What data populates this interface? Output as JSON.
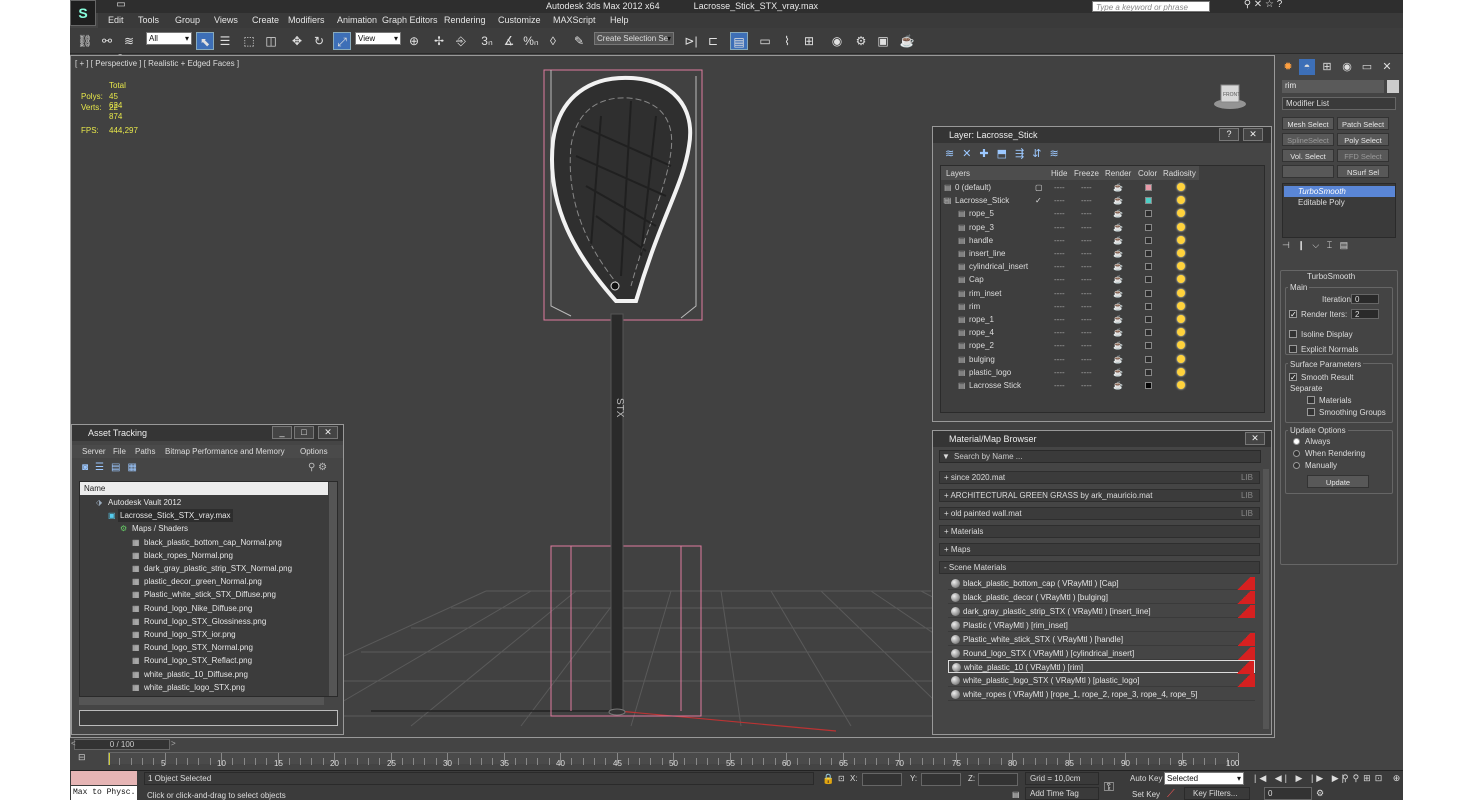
{
  "titlebar": {
    "app": "Autodesk 3ds Max  2012 x64",
    "file": "Lacrosse_Stick_STX_vray.max",
    "search_placeholder": "Type a keyword or phrase"
  },
  "menu": [
    "Edit",
    "Tools",
    "Group",
    "Views",
    "Create",
    "Modifiers",
    "Animation",
    "Graph Editors",
    "Rendering",
    "Customize",
    "MAXScript",
    "Help"
  ],
  "toolbar": {
    "filter": "All",
    "refcoord": "View",
    "selection_set": "Create Selection Se"
  },
  "viewport": {
    "label": "[ + ] [ Perspective ] [ Realistic + Edged Faces ]",
    "stats_header": "Total",
    "polys_label": "Polys:",
    "polys": "45 624",
    "verts_label": "Verts:",
    "verts": "22 874",
    "fps_label": "FPS:",
    "fps": "444,297",
    "viewcube": "FRONT"
  },
  "command_panel": {
    "object_name": "rim",
    "modifier_list": "Modifier List",
    "buttons": [
      [
        "Mesh Select",
        "Patch Select"
      ],
      [
        "SplineSelect",
        "Poly Select"
      ],
      [
        "Vol. Select",
        "FFD Select"
      ],
      [
        "",
        "NSurf Sel"
      ]
    ],
    "stack": [
      "TurboSmooth",
      "Editable Poly"
    ],
    "rollout_title": "TurboSmooth",
    "main_label": "Main",
    "iterations_label": "Iterations:",
    "iterations": "0",
    "render_iters_label": "Render Iters:",
    "render_iters": "2",
    "isoline": "Isoline Display",
    "explicit": "Explicit Normals",
    "surface_label": "Surface Parameters",
    "smooth_result": "Smooth Result",
    "separate": "Separate",
    "materials": "Materials",
    "smoothing_groups": "Smoothing Groups",
    "update_label": "Update Options",
    "always": "Always",
    "when_rendering": "When Rendering",
    "manually": "Manually",
    "update_btn": "Update"
  },
  "layer_window": {
    "title": "Layer: Lacrosse_Stick",
    "columns": [
      "Layers",
      "Hide",
      "Freeze",
      "Render",
      "Color",
      "Radiosity"
    ],
    "rows": [
      {
        "name": "0 (default)",
        "indent": 0,
        "color": "#e89aa8"
      },
      {
        "name": "Lacrosse_Stick",
        "indent": 0,
        "color": "#4ecfc6"
      },
      {
        "name": "rope_5",
        "indent": 1,
        "color": "#2c2c2c"
      },
      {
        "name": "rope_3",
        "indent": 1,
        "color": "#2c2c2c"
      },
      {
        "name": "handle",
        "indent": 1,
        "color": "#2c2c2c"
      },
      {
        "name": "insert_line",
        "indent": 1,
        "color": "#2c2c2c"
      },
      {
        "name": "cylindrical_insert",
        "indent": 1,
        "color": "#2c2c2c"
      },
      {
        "name": "Cap",
        "indent": 1,
        "color": "#2c2c2c"
      },
      {
        "name": "rim_inset",
        "indent": 1,
        "color": "#2c2c2c"
      },
      {
        "name": "rim",
        "indent": 1,
        "color": "#2c2c2c"
      },
      {
        "name": "rope_1",
        "indent": 1,
        "color": "#2c2c2c"
      },
      {
        "name": "rope_4",
        "indent": 1,
        "color": "#2c2c2c"
      },
      {
        "name": "rope_2",
        "indent": 1,
        "color": "#2c2c2c"
      },
      {
        "name": "bulging",
        "indent": 1,
        "color": "#2c2c2c"
      },
      {
        "name": "plastic_logo",
        "indent": 1,
        "color": "#2c2c2c"
      },
      {
        "name": "Lacrosse Stick",
        "indent": 1,
        "color": "#050505"
      }
    ],
    "dots": "----"
  },
  "material_browser": {
    "title": "Material/Map Browser",
    "search": "Search by Name ...",
    "sections": [
      {
        "label": "+ since 2020.mat",
        "lib": "LIB"
      },
      {
        "label": "+ ARCHITECTURAL GREEN GRASS by ark_mauricio.mat",
        "lib": "LIB"
      },
      {
        "label": "+ old painted wall.mat",
        "lib": "LIB"
      },
      {
        "label": "+ Materials",
        "lib": ""
      },
      {
        "label": "+ Maps",
        "lib": ""
      },
      {
        "label": "- Scene Materials",
        "lib": ""
      }
    ],
    "materials": [
      "black_plastic_bottom_cap  ( VRayMtl ) [Cap]",
      "black_plastic_decor  ( VRayMtl ) [bulging]",
      "dark_gray_plastic_strip_STX  ( VRayMtl ) [insert_line]",
      "Plastic  ( VRayMtl ) [rim_inset]",
      "Plastic_white_stick_STX  ( VRayMtl ) [handle]",
      "Round_logo_STX  ( VRayMtl ) [cylindrical_insert]",
      "white_plastic_10  ( VRayMtl ) [rim]",
      "white_plastic_logo_STX  ( VRayMtl ) [plastic_logo]",
      "white_ropes  ( VRayMtl ) [rope_1, rope_2, rope_3, rope_4, rope_5]"
    ]
  },
  "asset_tracking": {
    "title": "Asset Tracking",
    "menu": [
      "Server",
      "File",
      "Paths",
      "Bitmap Performance and Memory",
      "Options"
    ],
    "column": "Name",
    "items": [
      {
        "name": "Autodesk Vault 2012",
        "level": 0
      },
      {
        "name": "Lacrosse_Stick_STX_vray.max",
        "level": 1
      },
      {
        "name": "Maps / Shaders",
        "level": 2
      },
      {
        "name": "black_plastic_bottom_cap_Normal.png",
        "level": 3
      },
      {
        "name": "black_ropes_Normal.png",
        "level": 3
      },
      {
        "name": "dark_gray_plastic_strip_STX_Normal.png",
        "level": 3
      },
      {
        "name": "plastic_decor_green_Normal.png",
        "level": 3
      },
      {
        "name": "Plastic_white_stick_STX_Diffuse.png",
        "level": 3
      },
      {
        "name": "Round_logo_Nike_Diffuse.png",
        "level": 3
      },
      {
        "name": "Round_logo_STX_Glossiness.png",
        "level": 3
      },
      {
        "name": "Round_logo_STX_ior.png",
        "level": 3
      },
      {
        "name": "Round_logo_STX_Normal.png",
        "level": 3
      },
      {
        "name": "Round_logo_STX_Reflact.png",
        "level": 3
      },
      {
        "name": "white_plastic_10_Diffuse.png",
        "level": 3
      },
      {
        "name": "white_plastic_logo_STX.png",
        "level": 3
      }
    ]
  },
  "timeline": {
    "frame": "0 / 100",
    "ticks": [
      "5",
      "10",
      "15",
      "20",
      "25",
      "30",
      "35",
      "40",
      "45",
      "50",
      "55",
      "60",
      "65",
      "70",
      "75",
      "80",
      "85",
      "90",
      "95",
      "100"
    ]
  },
  "status": {
    "script": "Max to Physc.",
    "selected": "1 Object Selected",
    "hint": "Click or click-and-drag to select objects",
    "x_label": "X:",
    "y_label": "Y:",
    "z_label": "Z:",
    "grid": "Grid = 10,0cm",
    "add_time_tag": "Add Time Tag",
    "auto_key": "Auto Key",
    "set_key": "Set Key",
    "key_mode": "Selected",
    "key_filters": "Key Filters...",
    "frame_field": "0"
  }
}
